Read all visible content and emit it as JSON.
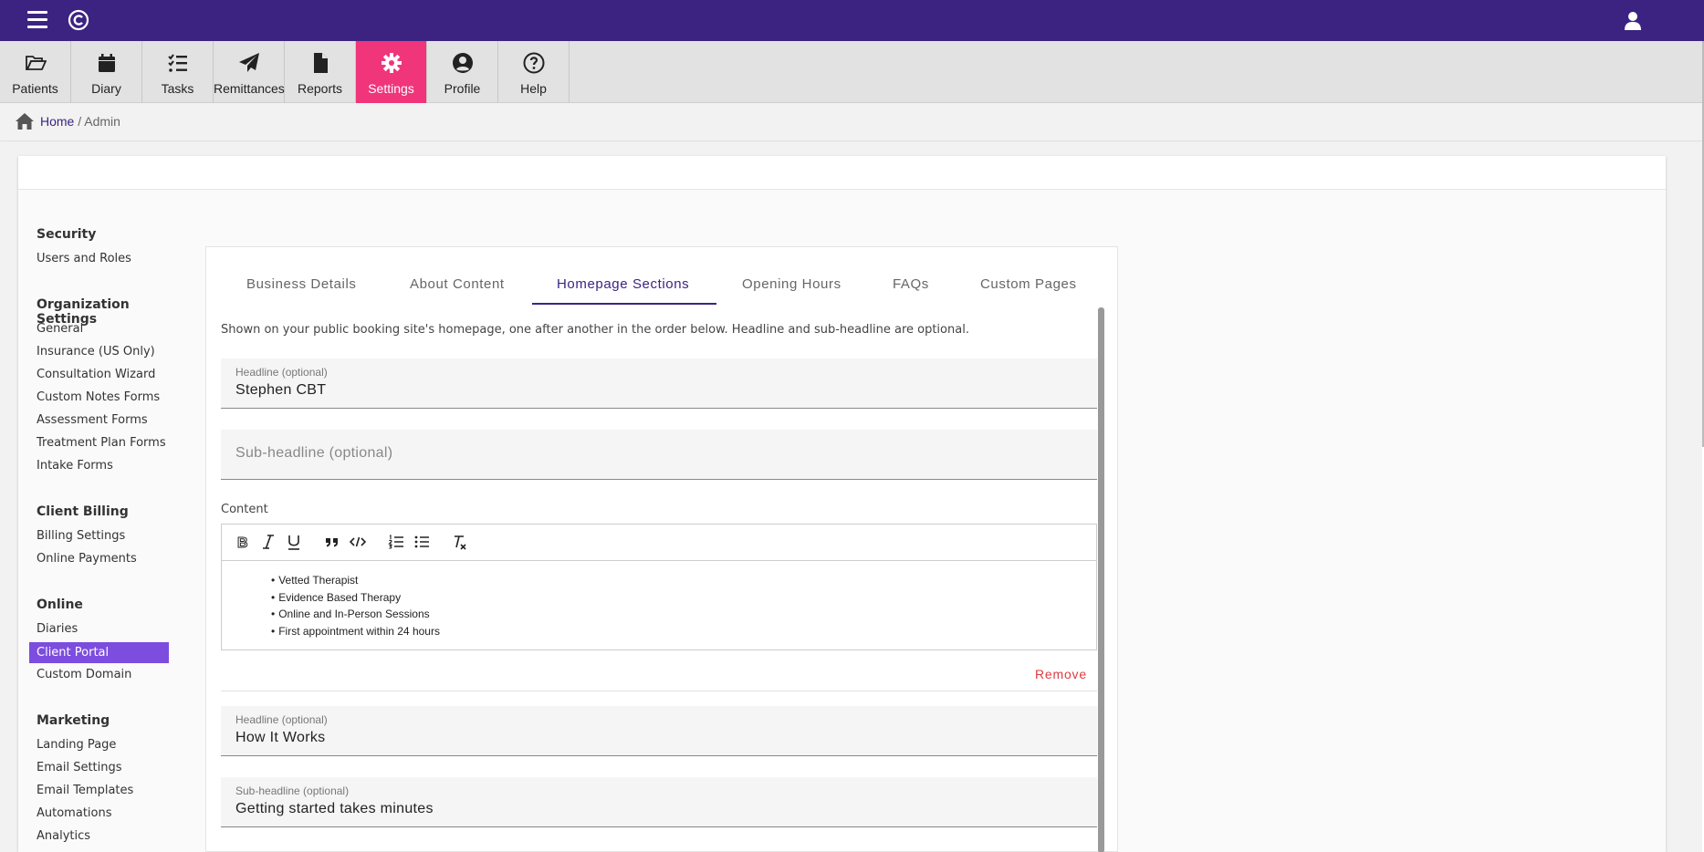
{
  "nav": {
    "items": [
      {
        "label": "Patients",
        "icon": "folder-open-icon"
      },
      {
        "label": "Diary",
        "icon": "calendar-icon"
      },
      {
        "label": "Tasks",
        "icon": "tasks-icon"
      },
      {
        "label": "Remittances",
        "icon": "paper-plane-icon"
      },
      {
        "label": "Reports",
        "icon": "file-icon"
      },
      {
        "label": "Settings",
        "icon": "gear-icon"
      },
      {
        "label": "Profile",
        "icon": "user-circle-icon"
      },
      {
        "label": "Help",
        "icon": "question-circle-icon"
      }
    ],
    "active_index": 5,
    "active_color": "#f0357a",
    "brand_color": "#3c2382"
  },
  "breadcrumb": {
    "home": "Home",
    "separator": "/",
    "current": "Admin"
  },
  "sidebar": {
    "sections": [
      {
        "heading": "Security",
        "items": [
          "Users and Roles"
        ]
      },
      {
        "heading": "Organization Settings",
        "items": [
          "General",
          "Insurance (US Only)",
          "Consultation Wizard",
          "Custom Notes Forms",
          "Assessment Forms",
          "Treatment Plan Forms",
          "Intake Forms"
        ]
      },
      {
        "heading": "Client Billing",
        "items": [
          "Billing Settings",
          "Online Payments"
        ]
      },
      {
        "heading": "Online",
        "items": [
          "Diaries",
          "Client Portal",
          "Custom Domain"
        ]
      },
      {
        "heading": "Marketing",
        "items": [
          "Landing Page",
          "Email Settings",
          "Email Templates",
          "Automations",
          "Analytics"
        ]
      }
    ],
    "active_item": "Client Portal"
  },
  "tabs": [
    "Business Details",
    "About Content",
    "Homepage Sections",
    "Opening Hours",
    "FAQs",
    "Custom Pages"
  ],
  "active_tab": "Homepage Sections",
  "description": "Shown on your public booking site's homepage, one after another in the order below. Headline and sub-headline are optional.",
  "sections": [
    {
      "headline_label": "Headline (optional)",
      "headline_value": "Stephen CBT",
      "subheadline_placeholder": "Sub-headline (optional)",
      "content_label": "Content",
      "content_items": [
        "Vetted Therapist",
        "Evidence Based Therapy",
        "Online and In-Person Sessions",
        "First appointment within 24 hours"
      ],
      "remove_label": "Remove"
    },
    {
      "headline_label": "Headline (optional)",
      "headline_value": "How It Works",
      "subheadline_label": "Sub-headline (optional)",
      "subheadline_value": "Getting started takes minutes"
    }
  ],
  "editor_toolbar": [
    "bold-icon",
    "italic-icon",
    "underline-icon",
    "blockquote-icon",
    "code-icon",
    "ordered-list-icon",
    "bullet-list-icon",
    "clear-format-icon"
  ]
}
